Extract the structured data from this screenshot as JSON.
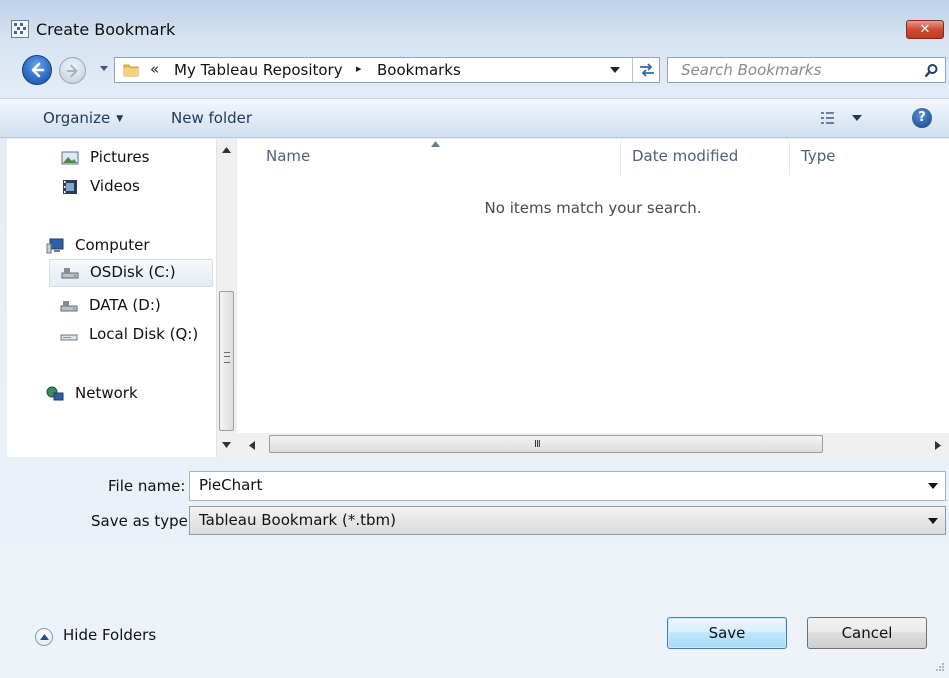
{
  "window": {
    "title": "Create Bookmark",
    "close_label": "✕"
  },
  "address_bar": {
    "lead": "«",
    "crumbs": [
      "My Tableau Repository",
      "Bookmarks"
    ],
    "separator": "▸"
  },
  "search": {
    "placeholder": "Search Bookmarks"
  },
  "toolbar": {
    "organize_label": "Organize",
    "new_folder_label": "New folder",
    "help_label": "?"
  },
  "nav_pane": {
    "items": [
      {
        "label": "Pictures",
        "icon": "pictures-icon"
      },
      {
        "label": "Videos",
        "icon": "videos-icon"
      },
      {
        "label": "Computer",
        "icon": "computer-icon"
      },
      {
        "label": "OSDisk (C:)",
        "icon": "drive-icon",
        "selected": true
      },
      {
        "label": "DATA (D:)",
        "icon": "drive-icon"
      },
      {
        "label": "Local Disk (Q:)",
        "icon": "removable-drive-icon"
      },
      {
        "label": "Network",
        "icon": "network-icon"
      }
    ]
  },
  "file_list": {
    "columns": [
      "Name",
      "Date modified",
      "Type"
    ],
    "empty_message": "No items match your search."
  },
  "form": {
    "file_name_label": "File name:",
    "file_name_value": "PieChart",
    "save_as_type_label": "Save as type:",
    "save_as_type_value": "Tableau Bookmark (*.tbm)"
  },
  "footer": {
    "hide_folders_label": "Hide Folders",
    "save_label": "Save",
    "cancel_label": "Cancel"
  },
  "colors": {
    "accent": "#2f6fc7",
    "close": "#c13a22",
    "toolbar_text": "#1d3c61"
  }
}
